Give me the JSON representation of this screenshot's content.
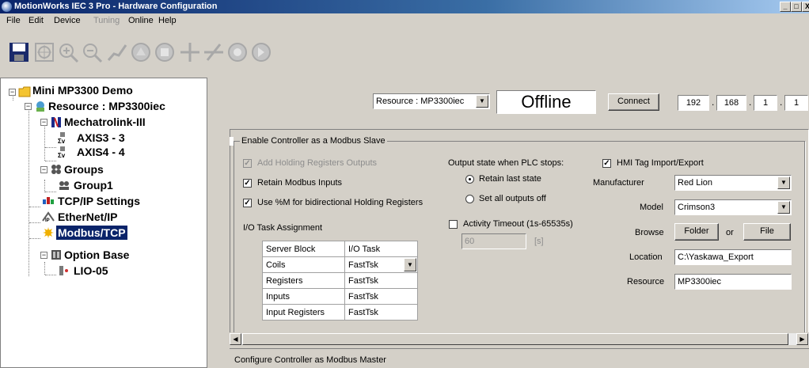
{
  "window": {
    "title": "MotionWorks IEC 3 Pro - Hardware Configuration",
    "controls": [
      "_",
      "□",
      "X"
    ]
  },
  "menu": [
    {
      "label": "File",
      "enabled": true
    },
    {
      "label": "Edit",
      "enabled": true
    },
    {
      "label": "Device",
      "enabled": true
    },
    {
      "label": "Tuning",
      "enabled": false
    },
    {
      "label": "Online",
      "enabled": true
    },
    {
      "label": "Help",
      "enabled": true
    }
  ],
  "toolbar": {
    "icons": [
      "save-icon",
      "fit-view-icon",
      "zoom-in-icon",
      "zoom-out-icon",
      "trend-icon",
      "gauge-icon",
      "servo-icon",
      "add-icon",
      "remove-icon",
      "connect-icon",
      "disconnect-icon"
    ]
  },
  "tree": {
    "root": "Mini MP3300 Demo",
    "resource": "Resource : MP3300iec",
    "mechatrolink": "Mechatrolink-III",
    "axis3": "AXIS3 - 3",
    "axis4": "AXIS4 - 4",
    "groups": "Groups",
    "group1": "Group1",
    "tcpip": "TCP/IP Settings",
    "ethernetip": "EtherNet/IP",
    "modbus": "Modbus/TCP",
    "optionbase": "Option Base",
    "lio": "LIO-05"
  },
  "header": {
    "resource_select": "Resource : MP3300iec",
    "status": "Offline",
    "connect_label": "Connect",
    "ip": [
      "192",
      "168",
      "1",
      "1"
    ]
  },
  "slave": {
    "group_title": "Enable Controller as a Modbus Slave",
    "add_holding": {
      "label": "Add Holding Registers Outputs",
      "checked": true,
      "enabled": false
    },
    "retain_inputs": {
      "label": "Retain Modbus Inputs",
      "checked": true
    },
    "use_m": {
      "label": "Use %M for bidirectional Holding Registers",
      "checked": true
    },
    "io_task_label": "I/O Task Assignment",
    "table": {
      "headers": [
        "Server Block",
        "I/O Task"
      ],
      "rows": [
        [
          "Coils",
          "FastTsk"
        ],
        [
          "Registers",
          "FastTsk"
        ],
        [
          "Inputs",
          "FastTsk"
        ],
        [
          "Input Registers",
          "FastTsk"
        ]
      ]
    },
    "output_state_label": "Output state when PLC stops:",
    "retain_last": "Retain last state",
    "set_all_off": "Set all outputs off",
    "activity_timeout": {
      "label": "Activity Timeout (1s-65535s)",
      "checked": false
    },
    "timeout_value": "60",
    "timeout_unit": "[s]",
    "hmi": {
      "label": "HMI Tag Import/Export",
      "checked": true
    },
    "manufacturer_label": "Manufacturer",
    "manufacturer_value": "Red Lion",
    "model_label": "Model",
    "model_value": "Crimson3",
    "browse_label": "Browse",
    "folder_btn": "Folder",
    "or_text": "or",
    "file_btn": "File",
    "location_label": "Location",
    "location_value": "C:\\Yaskawa_Export",
    "resource_label": "Resource",
    "resource_value": "MP3300iec"
  },
  "master": {
    "group_title": "Configure Controller as Modbus Master"
  }
}
